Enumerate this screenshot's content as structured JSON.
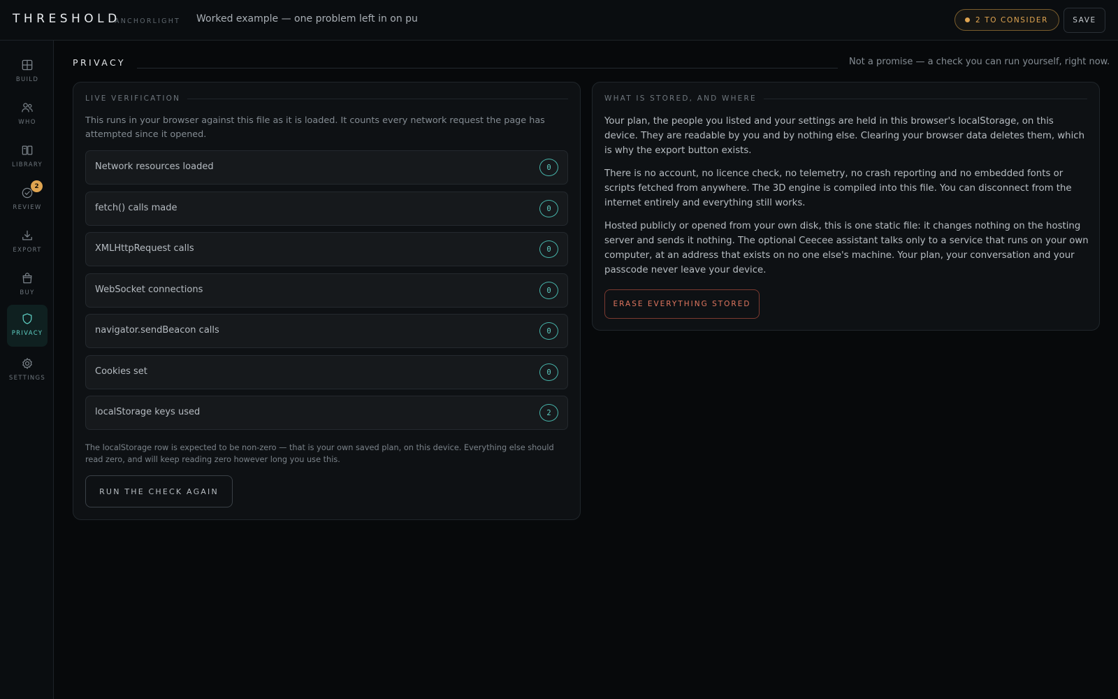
{
  "app": {
    "brand": "THRESHOLD",
    "brand_sub": "ANCHORLIGHT",
    "document_title": "Worked example — one problem left in on purpose"
  },
  "header": {
    "consider_label": "2 TO CONSIDER",
    "save_label": "SAVE",
    "consider_color": "#e0a551"
  },
  "sidebar": {
    "items": [
      {
        "label": "BUILD",
        "icon": "grid-icon"
      },
      {
        "label": "WHO",
        "icon": "people-icon"
      },
      {
        "label": "LIBRARY",
        "icon": "book-icon"
      },
      {
        "label": "REVIEW",
        "icon": "check-circle-icon",
        "badge": "2"
      },
      {
        "label": "EXPORT",
        "icon": "download-icon"
      },
      {
        "label": "BUY",
        "icon": "shopping-bag-icon"
      },
      {
        "label": "PRIVACY",
        "icon": "shield-icon",
        "active": true
      },
      {
        "label": "SETTINGS",
        "icon": "gear-icon"
      }
    ],
    "accent": "#5fd0c4"
  },
  "section": {
    "title": "PRIVACY",
    "note": "Not a promise — a check you can run yourself, right now."
  },
  "live": {
    "heading": "LIVE VERIFICATION",
    "intro": "This runs in your browser against this file as it is loaded. It counts every network request the page has attempted since it opened.",
    "rows": [
      {
        "label": "Network resources loaded",
        "value": "0"
      },
      {
        "label": "fetch() calls made",
        "value": "0"
      },
      {
        "label": "XMLHttpRequest calls",
        "value": "0"
      },
      {
        "label": "WebSocket connections",
        "value": "0"
      },
      {
        "label": "navigator.sendBeacon calls",
        "value": "0"
      },
      {
        "label": "Cookies set",
        "value": "0"
      },
      {
        "label": "localStorage keys used",
        "value": "2"
      }
    ],
    "footnote": "The localStorage row is expected to be non-zero — that is your own saved plan, on this device. Everything else should read zero, and will keep reading zero however long you use this.",
    "rerun_label": "RUN THE CHECK AGAIN"
  },
  "stored": {
    "heading": "WHAT IS STORED, AND WHERE",
    "paragraphs": [
      "Your plan, the people you listed and your settings are held in this browser's localStorage, on this device. They are readable by you and by nothing else. Clearing your browser data deletes them, which is why the export button exists.",
      "There is no account, no licence check, no telemetry, no crash reporting and no embedded fonts or scripts fetched from anywhere. The 3D engine is compiled into this file. You can disconnect from the internet entirely and everything still works.",
      "Hosted publicly or opened from your own disk, this is one static file: it changes nothing on the hosting server and sends it nothing. The optional Ceecee assistant talks only to a service that runs on your own computer, at an address that exists on no one else's machine. Your plan, your conversation and your passcode never leave your device."
    ],
    "erase_label": "ERASE EVERYTHING STORED",
    "erase_color": "#e0765f"
  }
}
